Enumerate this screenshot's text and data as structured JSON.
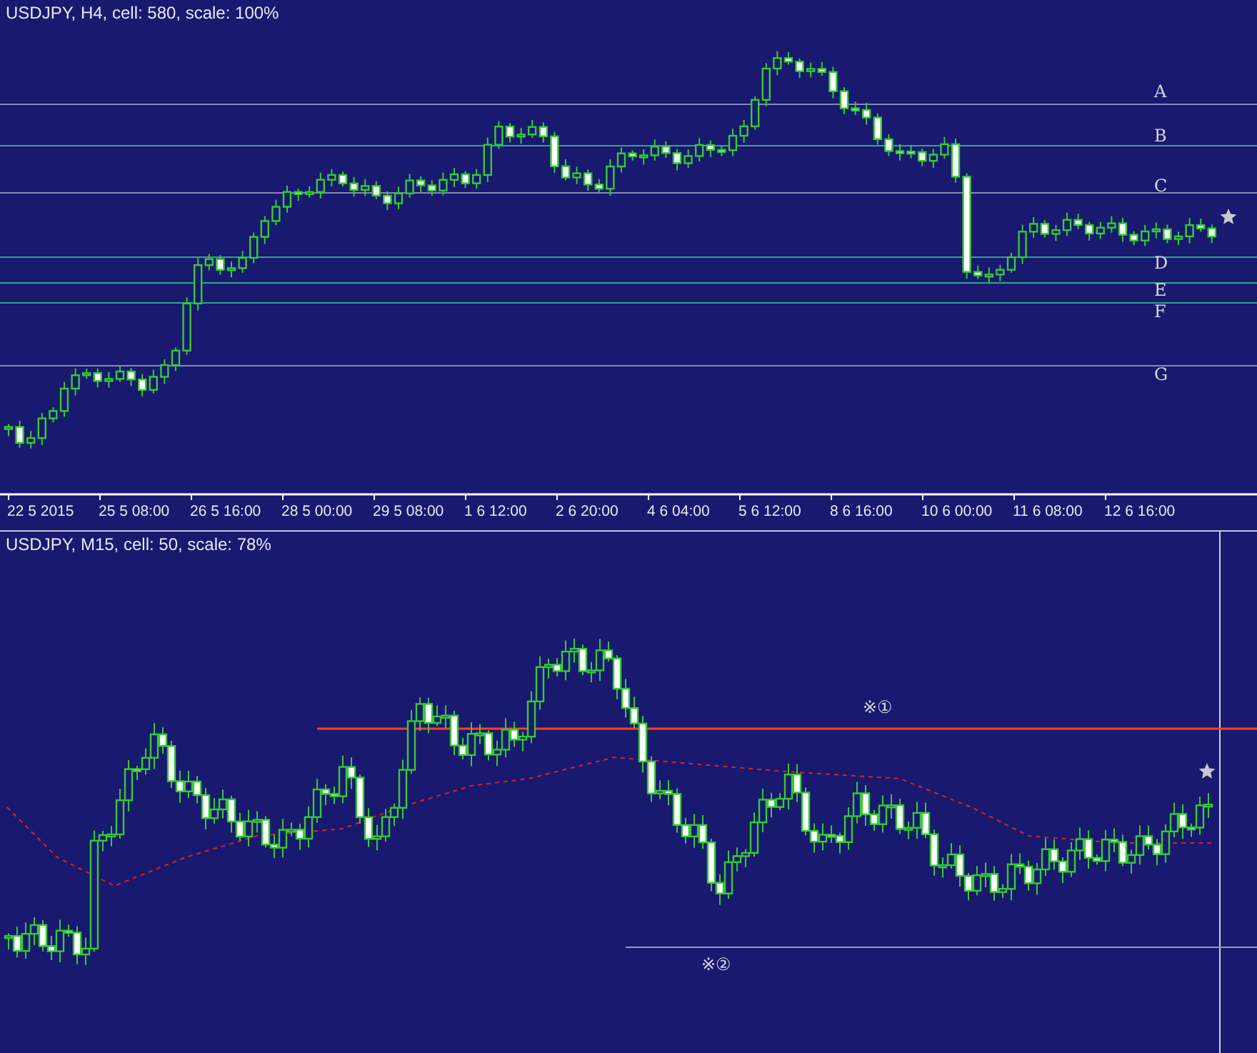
{
  "top_chart": {
    "title": "USDJPY, H4, cell: 580, scale: 100%",
    "levels": [
      {
        "label": "A",
        "kind": "grey"
      },
      {
        "label": "B",
        "kind": "teal"
      },
      {
        "label": "C",
        "kind": "grey"
      },
      {
        "label": "D",
        "kind": "teal"
      },
      {
        "label": "E",
        "kind": "teal"
      },
      {
        "label": "F",
        "kind": "teal"
      },
      {
        "label": "G",
        "kind": "grey"
      }
    ],
    "x_labels": [
      "22 5 2015",
      "25 5 08:00",
      "26 5 16:00",
      "28 5 00:00",
      "29 5 08:00",
      "1 6 12:00",
      "2 6 20:00",
      "4 6 04:00",
      "5 6 12:00",
      "8 6 16:00",
      "10 6 00:00",
      "11 6 08:00",
      "12 6 16:00"
    ]
  },
  "bottom_chart": {
    "title": "USDJPY, M15, cell: 50, scale: 78%",
    "annotations": [
      "※①",
      "※②"
    ]
  }
}
